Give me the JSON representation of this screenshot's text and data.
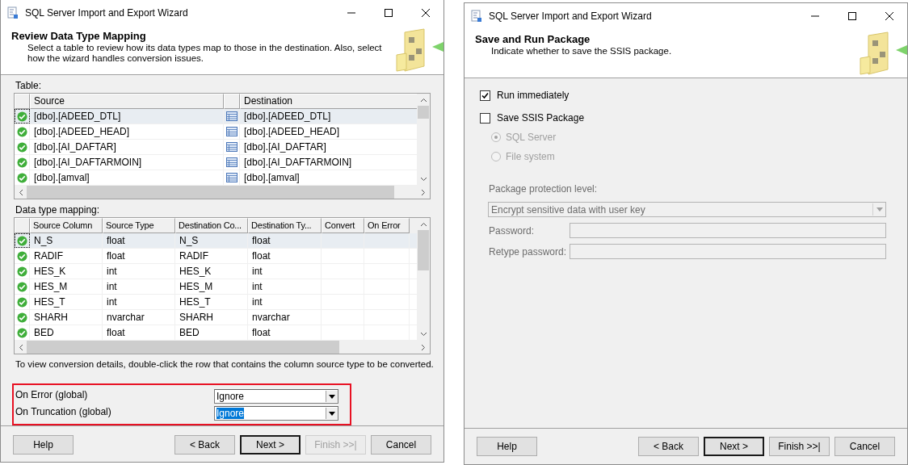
{
  "mapping_window": {
    "title": "SQL Server Import and Export Wizard",
    "heading": "Review Data Type Mapping",
    "description": "Select a table to review how its data types map to those in the destination. Also, select how the wizard handles conversion issues.",
    "table_label": "Table:",
    "tables": {
      "columns": [
        "Source",
        "Destination"
      ],
      "rows": [
        {
          "source": "[dbo].[ADEED_DTL]",
          "destination": "[dbo].[ADEED_DTL]",
          "selected": true
        },
        {
          "source": "[dbo].[ADEED_HEAD]",
          "destination": "[dbo].[ADEED_HEAD]",
          "selected": false
        },
        {
          "source": "[dbo].[AI_DAFTAR]",
          "destination": "[dbo].[AI_DAFTAR]",
          "selected": false
        },
        {
          "source": "[dbo].[AI_DAFTARMOIN]",
          "destination": "[dbo].[AI_DAFTARMOIN]",
          "selected": false
        },
        {
          "source": "[dbo].[amval]",
          "destination": "[dbo].[amval]",
          "selected": false
        }
      ]
    },
    "mapping_label": "Data type mapping:",
    "mapping": {
      "columns": [
        "Source Column",
        "Source Type",
        "Destination Co...",
        "Destination Ty...",
        "Convert",
        "On Error"
      ],
      "rows": [
        {
          "source_column": "N_S",
          "source_type": "float",
          "destination_column": "N_S",
          "destination_type": "float",
          "selected": true
        },
        {
          "source_column": "RADIF",
          "source_type": "float",
          "destination_column": "RADIF",
          "destination_type": "float",
          "selected": false
        },
        {
          "source_column": "HES_K",
          "source_type": "int",
          "destination_column": "HES_K",
          "destination_type": "int",
          "selected": false
        },
        {
          "source_column": "HES_M",
          "source_type": "int",
          "destination_column": "HES_M",
          "destination_type": "int",
          "selected": false
        },
        {
          "source_column": "HES_T",
          "source_type": "int",
          "destination_column": "HES_T",
          "destination_type": "int",
          "selected": false
        },
        {
          "source_column": "SHARH",
          "source_type": "nvarchar",
          "destination_column": "SHARH",
          "destination_type": "nvarchar",
          "selected": false
        },
        {
          "source_column": "BED",
          "source_type": "float",
          "destination_column": "BED",
          "destination_type": "float",
          "selected": false
        }
      ]
    },
    "hint": "To view conversion details, double-click the row that contains the column source type to be converted.",
    "options": [
      {
        "label": "On Error (global)",
        "value": "Ignore",
        "focused": false
      },
      {
        "label": "On Truncation (global)",
        "value": "Ignore",
        "focused": true
      }
    ],
    "buttons": [
      {
        "label": "Help",
        "disabled": false,
        "default": false
      },
      {
        "label": "< Back",
        "disabled": false,
        "default": false
      },
      {
        "label": "Next >",
        "disabled": false,
        "default": true
      },
      {
        "label": "Finish >>|",
        "disabled": true,
        "default": false
      },
      {
        "label": "Cancel",
        "disabled": false,
        "default": false
      }
    ]
  },
  "package_window": {
    "title": "SQL Server Import and Export Wizard",
    "heading": "Save and Run Package",
    "description": "Indicate whether to save the SSIS package.",
    "checkboxes": [
      {
        "label": "Run immediately",
        "checked": true
      },
      {
        "label": "Save SSIS Package",
        "checked": false
      }
    ],
    "radios": [
      {
        "label": "SQL Server",
        "selected": true,
        "disabled": true
      },
      {
        "label": "File system",
        "selected": false,
        "disabled": true
      }
    ],
    "protection_label": "Package protection level:",
    "protection_value": "Encrypt sensitive data with user key",
    "protection_disabled": true,
    "fields": [
      {
        "label": "Password:"
      },
      {
        "label": "Retype password:"
      }
    ],
    "buttons": [
      {
        "label": "Help",
        "disabled": false,
        "default": false
      },
      {
        "label": "< Back",
        "disabled": false,
        "default": false
      },
      {
        "label": "Next >",
        "disabled": false,
        "default": true
      },
      {
        "label": "Finish >>|",
        "disabled": false,
        "default": false
      },
      {
        "label": "Cancel",
        "disabled": false,
        "default": false
      }
    ]
  }
}
